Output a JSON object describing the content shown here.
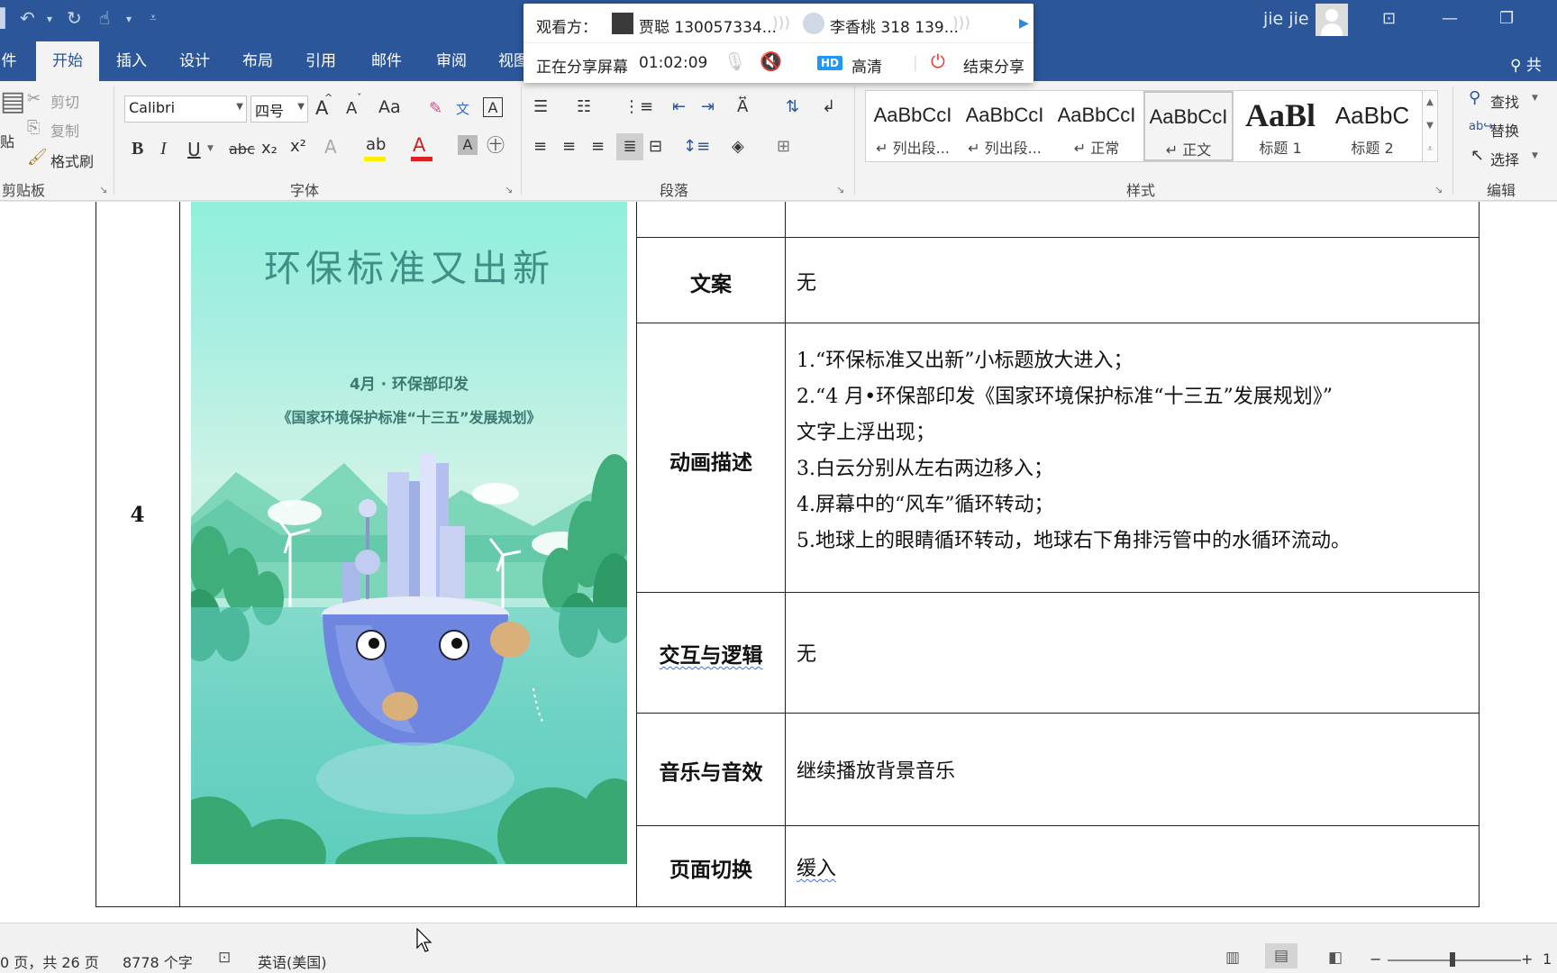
{
  "titlebar": {
    "user_name": "jie jie",
    "minimize": "—",
    "restore": "❐",
    "ribbon_display": "⊡"
  },
  "tabs": [
    {
      "label": "件"
    },
    {
      "label": "开始"
    },
    {
      "label": "插入"
    },
    {
      "label": "设计"
    },
    {
      "label": "布局"
    },
    {
      "label": "引用"
    },
    {
      "label": "邮件"
    },
    {
      "label": "审阅"
    },
    {
      "label": "视图"
    }
  ],
  "share_label": "共",
  "ribbon": {
    "clipboard": {
      "paste": "贴",
      "cut": "剪切",
      "copy": "复制",
      "format_painter": "格式刷",
      "group": "剪贴板"
    },
    "font": {
      "name": "Calibri",
      "size": "四号",
      "grow": "A",
      "shrink": "A",
      "case": "Aa",
      "bold": "B",
      "italic": "I",
      "underline": "U",
      "strike": "abc",
      "subscript": "x₂",
      "superscript": "x²",
      "group": "字体"
    },
    "paragraph": {
      "group": "段落"
    },
    "styles": {
      "group": "样式",
      "items": [
        {
          "preview": "AaBbCcI",
          "name": "列出段..."
        },
        {
          "preview": "AaBbCcI",
          "name": "列出段..."
        },
        {
          "preview": "AaBbCcI",
          "name": "正常"
        },
        {
          "preview": "AaBbCcI",
          "name": "正文"
        },
        {
          "preview": "AaBl",
          "name": "标题 1"
        },
        {
          "preview": "AaBbC",
          "name": "标题 2"
        }
      ]
    },
    "editing": {
      "find": "查找",
      "replace": "替换",
      "select": "选择",
      "group": "编辑"
    }
  },
  "meeting": {
    "viewers_label": "观看方：",
    "viewer1": "贾聪 130057334...",
    "viewer2": "李香桃 318 139...",
    "sharing_status": "正在分享屏幕",
    "timer": "01:02:09",
    "hd_badge": "HD",
    "hd_label": "高清",
    "end_share": "结束分享"
  },
  "document": {
    "row_number": "4",
    "poster": {
      "title": "环保标准又出新",
      "line1": "4月 · 环保部印发",
      "line2": "《国家环境保护标准“十三五”发展规划》"
    },
    "rows": {
      "copy": {
        "label": "文案",
        "value": "无"
      },
      "animation": {
        "label": "动画描述",
        "lines": [
          "1.“环保标准又出新”小标题放大进入；",
          "2.“4 月•环保部印发《国家环境保护标准“十三五”发展规划》”",
          "文字上浮出现；",
          "3.白云分别从左右两边移入；",
          "4.屏幕中的“风车”循环转动；",
          "5.地球上的眼睛循环转动，地球右下角排污管中的水循环流动。"
        ]
      },
      "interaction": {
        "label": "交互与逻辑",
        "value": "无"
      },
      "music": {
        "label": "音乐与音效",
        "value": "继续播放背景音乐"
      },
      "transition": {
        "label": "页面切换",
        "value": "缓入"
      }
    }
  },
  "statusbar": {
    "page": "0 页，共 26 页",
    "words": "8778 个字",
    "language": "英语(美国)",
    "zoom_minus": "−",
    "zoom_plus": "+",
    "zoom_value": "1"
  }
}
